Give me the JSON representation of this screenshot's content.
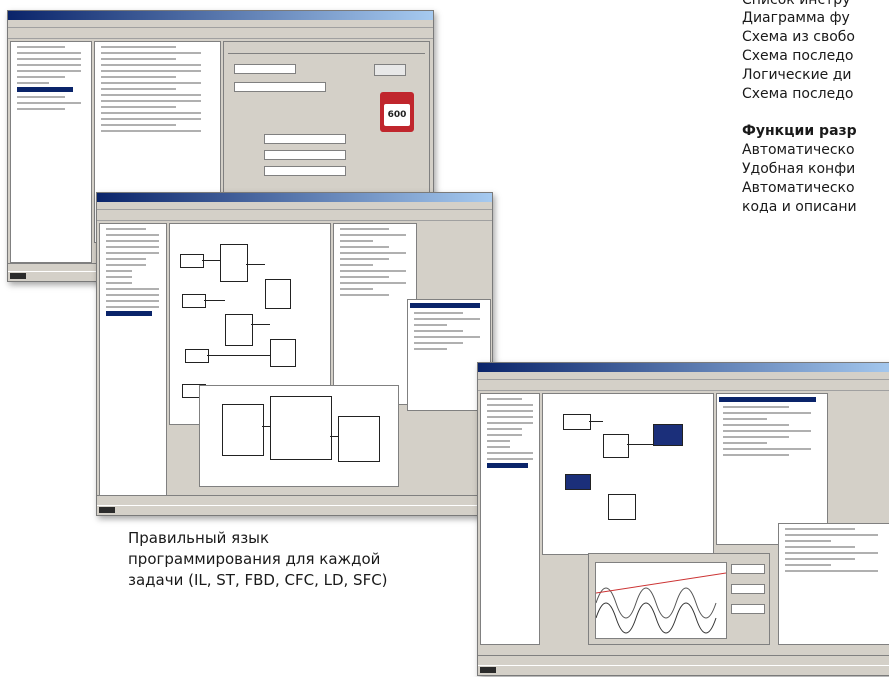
{
  "caption": {
    "line1": "Правильный язык",
    "line2": "программирования для каждой",
    "line3": "задачи (IL, ST, FBD, CFC, LD, SFC)"
  },
  "features_list": {
    "items": [
      "Список инстру",
      "Диаграмма фу",
      "Схема из свобо",
      "Схема последо",
      "Логические ди",
      "Схема последо"
    ]
  },
  "dev_functions": {
    "heading": "Функции разр",
    "items": [
      "Автоматическо",
      "Удобная конфи",
      "Автоматическо",
      "кода и описани"
    ]
  },
  "screenshot1": {
    "badge": "600"
  }
}
